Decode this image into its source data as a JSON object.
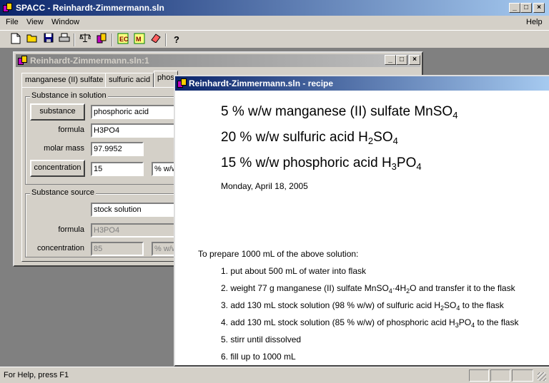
{
  "app": {
    "title": "SPACC - Reinhardt-Zimmermann.sln",
    "caption_buttons": [
      "_",
      "□",
      "×"
    ]
  },
  "menu": {
    "file": "File",
    "view": "View",
    "window": "Window",
    "help": "Help"
  },
  "toolbar": {
    "icons": [
      "new-file-icon",
      "open-folder-icon",
      "save-icon",
      "print-icon",
      "balance-scale-icon",
      "flasks-icon",
      "calculator-icon",
      "molar-mass-icon",
      "eraser-icon",
      "help-question-icon"
    ]
  },
  "child1": {
    "title": "Reinhardt-Zimmermann.sln:1",
    "tabs": [
      "manganese (II) sulfate",
      "sulfuric acid",
      "phos"
    ],
    "solution_group": {
      "label": "Substance in solution",
      "substance_button": "substance",
      "substance_value": "phosphoric acid",
      "formula_label": "formula",
      "formula_value": "H3PO4",
      "molar_mass_label": "molar mass",
      "molar_mass_value": "97.9952",
      "concentration_button": "concentration",
      "concentration_value": "15",
      "unit_value": "% w/w"
    },
    "source_group": {
      "label": "Substance source",
      "source_value": "stock solution",
      "formula_label": "formula",
      "formula_value": "H3PO4",
      "concentration_label": "concentration",
      "concentration_value": "85",
      "unit_value": "% w/w"
    }
  },
  "recipe": {
    "title": "Reinhardt-Zimmermann.sln - recipe",
    "components": [
      {
        "text": "5 % w/w manganese (II) sulfate MnSO",
        "sub": "4"
      },
      {
        "text": "20 % w/w sulfuric acid H",
        "sub": "2",
        "tail": "SO",
        "sub2": "4"
      },
      {
        "text": "15 % w/w phosphoric acid H",
        "sub": "3",
        "tail": "PO",
        "sub2": "4"
      }
    ],
    "date": "Monday, April 18, 2005",
    "prepare": "To prepare 1000 mL of the above solution:",
    "steps": {
      "s1": "1. put about 500 mL of water into flask",
      "s2a": "2. weight 77 g manganese (II) sulfate MnSO",
      "s2sub1": "4",
      "s2b": "·4H",
      "s2sub2": "2",
      "s2c": "O and transfer it to the flask",
      "s3a": "3. add 130 mL stock solution (98 % w/w) of sulfuric acid H",
      "s3sub1": "2",
      "s3b": "SO",
      "s3sub2": "4",
      "s3c": " to the flask",
      "s4a": "4. add 130 mL stock solution (85 % w/w) of phosphoric acid H",
      "s4sub1": "3",
      "s4b": "PO",
      "s4sub2": "4",
      "s4c": " to the flask",
      "s5": "5. stirr until dissolved",
      "s6": "6. fill up to 1000 mL"
    }
  },
  "status": {
    "text": "For Help, press F1"
  }
}
